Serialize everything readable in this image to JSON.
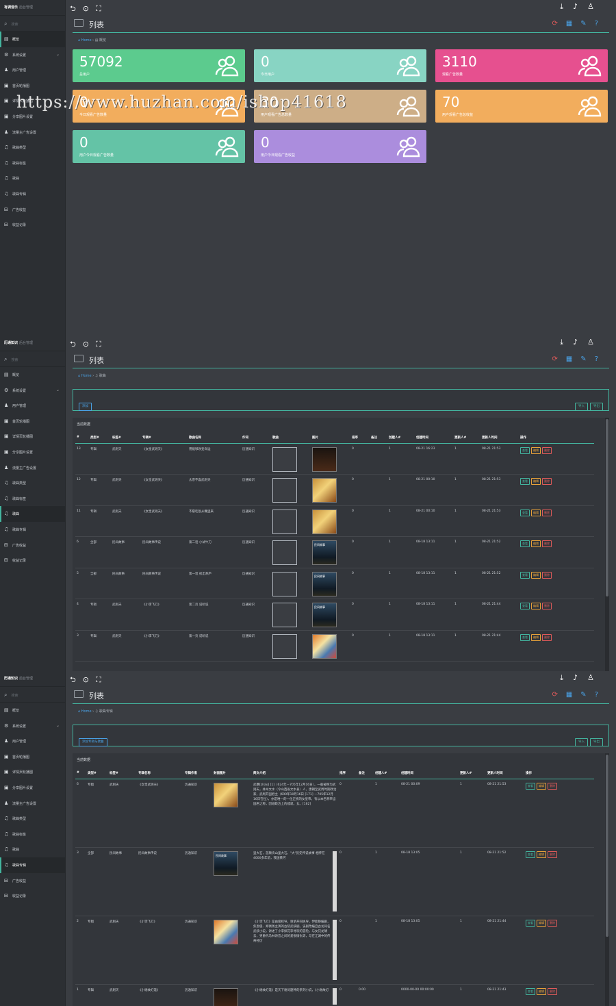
{
  "app": {
    "brand": "历通知识",
    "brand_sub": "后台管理",
    "brand_first": "有调音乐"
  },
  "sidebar": {
    "search_placeholder": "搜索",
    "items": [
      "概览",
      "系统设置",
      "用户管理",
      "首页轮播图",
      "详情页轮播图",
      "分享图片设置",
      "流量主广告设置",
      "歌曲类型",
      "歌曲标签",
      "歌曲",
      "歌曲专辑",
      "广告收益",
      "收益记录"
    ]
  },
  "topbar": {
    "left_icons": [
      "back-icon",
      "refresh-icon",
      "fullscreen-icon"
    ],
    "right_icons": [
      "download-icon",
      "bell-icon",
      "user-icon"
    ]
  },
  "panel1": {
    "title": "列表",
    "crumb_home": "Home",
    "crumb_page": "概览",
    "cards": [
      {
        "value": "57092",
        "label": "总用户",
        "color": "#5ccb8e"
      },
      {
        "value": "0",
        "label": "今日用户",
        "color": "#88d4c3"
      },
      {
        "value": "3110",
        "label": "观看广告数量",
        "color": "#e6508f"
      },
      {
        "value": "0",
        "label": "今日观看广告数量",
        "color": "#f2ad5d"
      },
      {
        "value": "30",
        "label": "用户观看广告总数量",
        "color": "#cdae87"
      },
      {
        "value": "70",
        "label": "用户观看广告总收益",
        "color": "#f2ad5d"
      },
      {
        "value": "0",
        "label": "用户今日观看广告数量",
        "color": "#64c3a6"
      },
      {
        "value": "0",
        "label": "用户今日观看广告收益",
        "color": "#ab8ddd"
      }
    ]
  },
  "panel2": {
    "title": "列表",
    "crumb_home": "Home",
    "crumb_page": "歌曲",
    "add_label": "添加",
    "import_label": "导入",
    "export_label": "导出",
    "caption": "当前数据",
    "headers": [
      "#",
      "类型#",
      "标签#",
      "专辑#",
      "歌曲名称",
      "作词",
      "歌曲",
      "图片",
      "排序",
      "备注",
      "创建人#",
      "创建时间",
      "更新人#",
      "更新人时间",
      "操作"
    ],
    "rows": [
      {
        "id": "13",
        "type": "专辑",
        "tag": "武则天",
        "album": "《女皇武则天》",
        "name": "用能够改变命运",
        "lyric": "历通知识",
        "cover": "cv-black",
        "sort": "0",
        "note": "",
        "creator": "1",
        "ctime": "08-21 16:23",
        "updater": "1",
        "utime": "08-21 21:53"
      },
      {
        "id": "12",
        "type": "专辑",
        "tag": "武则天",
        "album": "《女皇武则天》",
        "name": "太宗不喜武则天",
        "lyric": "历通知识",
        "cover": "cv-gold",
        "sort": "0",
        "note": "",
        "creator": "1",
        "ctime": "08-21 00:10",
        "updater": "1",
        "utime": "08-21 21:53"
      },
      {
        "id": "11",
        "type": "专辑",
        "tag": "武则天",
        "album": "《女皇武则天》",
        "name": "不愿吃饭从嘴里来",
        "lyric": "历通知识",
        "cover": "cv-gold",
        "sort": "0",
        "note": "",
        "creator": "1",
        "ctime": "08-21 00:10",
        "updater": "1",
        "utime": "08-21 21:53"
      },
      {
        "id": "6",
        "type": "全部",
        "tag": "民间故事",
        "album": "民间故事传说",
        "name": "第二话 小试牛刀",
        "lyric": "历通知识",
        "cover": "cv-night",
        "sort": "0",
        "note": "",
        "creator": "1",
        "ctime": "08-18 13:11",
        "updater": "1",
        "utime": "08-21 21:52"
      },
      {
        "id": "5",
        "type": "全部",
        "tag": "民间故事",
        "album": "民间故事传说",
        "name": "第一话 初出茅庐",
        "lyric": "历通知识",
        "cover": "cv-night",
        "sort": "0",
        "note": "",
        "creator": "1",
        "ctime": "08-18 13:11",
        "updater": "1",
        "utime": "08-21 21:52"
      },
      {
        "id": "4",
        "type": "专辑",
        "tag": "武则天",
        "album": "《小李飞刀》",
        "name": "第二页 说听说",
        "lyric": "历通知识",
        "cover": "cv-night",
        "sort": "0",
        "note": "",
        "creator": "1",
        "ctime": "08-18 13:11",
        "updater": "1",
        "utime": "08-21 21:44"
      },
      {
        "id": "3",
        "type": "专辑",
        "tag": "武则天",
        "album": "《小李飞刀》",
        "name": "第一页 说听说",
        "lyric": "历通知识",
        "cover": "cv-color",
        "sort": "0",
        "note": "",
        "creator": "1",
        "ctime": "08-18 13:11",
        "updater": "1",
        "utime": "08-21 21:44"
      }
    ],
    "ops": {
      "view": "查看",
      "edit": "编辑",
      "del": "删除"
    }
  },
  "panel3": {
    "title": "列表",
    "crumb_home": "Home",
    "crumb_page": "歌曲专辑",
    "add_label": "添加专辑与歌曲",
    "import_label": "导入",
    "export_label": "导出",
    "caption": "当前数据",
    "headers": [
      "#",
      "类型#",
      "标签#",
      "专辑名称",
      "专辑作者",
      "封面图片",
      "简文介绍",
      "排序",
      "备注",
      "创建人#",
      "创建时间",
      "更新人#",
      "更新人时间",
      "操作"
    ],
    "rows": [
      {
        "id": "6",
        "type": "专辑",
        "tag": "武则天",
        "name": "《女皇武则天》",
        "author": "历通知识",
        "cover": "cv-gold",
        "intro": "武瞾[zhào] [1]（624年－705年12月16日），一般被称为武则天，并州文水（今山西省文水县）人，唐朝至武周时期政治家，武周开国君主（690年10月16日 [171] －705年12月16日在位），亦是唯一的一位正统的女皇帝，有以本名称帝当国君之称，因她政治上的成就，女。[162]",
        "sort": "0",
        "note": "",
        "creator": "1",
        "ctime": "08-21 00:09",
        "updater": "1",
        "utime": "08-21 21:53"
      },
      {
        "id": "3",
        "type": "全部",
        "tag": "民间故事",
        "name": "民间故事传说",
        "author": "历通知识",
        "cover": "cv-night",
        "intro": "里大石，首颇块山里大石，\"大\"历史传说故事 相传在4000多年前，我国黄河",
        "sort": "0",
        "note": "",
        "creator": "1",
        "ctime": "08-18 13:05",
        "updater": "1",
        "utime": "08-21 21:52"
      },
      {
        "id": "2",
        "type": "专辑",
        "tag": "武则天",
        "name": "《小李飞刀》",
        "author": "历通知识",
        "cover": "cv-color",
        "intro": "《小李飞刀》是由俊权导，谢承开同执导，伊能静编剧，焦恩俊、郑佩佩主演的古装武侠剧。该剧改编自古龙同名武侠小说，讲述了小李探花李寻欢的冒险，与女兄龙啸云，男爵代马林诗音之间的爱恨情仇等，与在江湖中的传奇经历",
        "sort": "0",
        "note": "",
        "creator": "1",
        "ctime": "08-18 13:05",
        "updater": "1",
        "utime": "08-21 21:44"
      },
      {
        "id": "1",
        "type": "专辑",
        "tag": "武则天",
        "name": "《小谢故灯笼》",
        "author": "历通知识",
        "cover": "cv-black",
        "intro": "《小谢故灯笼》是天下谢问题神的系列小说，《小谢故灯",
        "sort": "0",
        "note": "0.00",
        "creator": "",
        "ctime": "0000-00-00 00:00:00",
        "updater": "1",
        "utime": "08-21 21:43"
      }
    ],
    "ops": {
      "view": "查看",
      "edit": "编辑",
      "del": "删除"
    }
  },
  "cover_titles": {
    "cv-dark": "民间故事",
    "cv-night": "民间故事"
  },
  "watermark": "https://www.huzhan.com/ishop41618"
}
